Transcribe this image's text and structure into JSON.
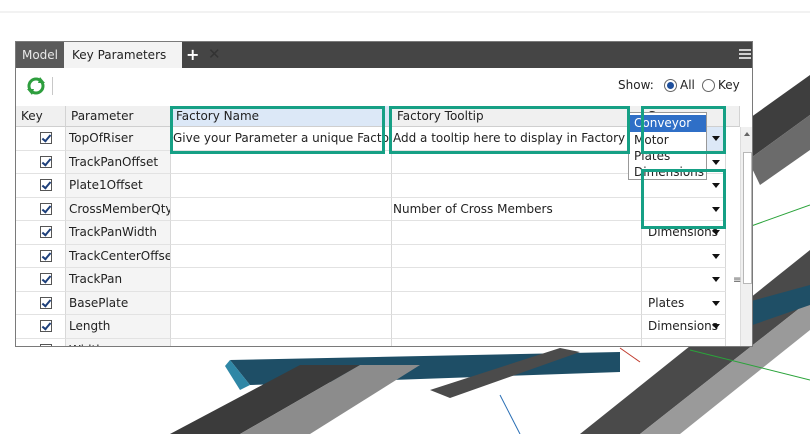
{
  "tabs": [
    {
      "label": "Model"
    },
    {
      "label": "Key Parameters"
    }
  ],
  "toolbar": {
    "show_label": "Show:",
    "options": [
      {
        "label": "All",
        "selected": true
      },
      {
        "label": "Key",
        "selected": false
      }
    ]
  },
  "columns": [
    "Key",
    "Parameter",
    "Factory Name",
    "Factory Tooltip",
    "Group"
  ],
  "rows": [
    {
      "key": true,
      "parameter": "TopOfRiser",
      "factory_name": "Give your Parameter a unique Factory Name",
      "factory_tooltip": "Add a tooltip here to display in Factory Properties",
      "group": "Conveyor"
    },
    {
      "key": true,
      "parameter": "TrackPanOffset",
      "factory_name": "",
      "factory_tooltip": "",
      "group": ""
    },
    {
      "key": true,
      "parameter": "Plate1Offset",
      "factory_name": "",
      "factory_tooltip": "",
      "group": ""
    },
    {
      "key": true,
      "parameter": "CrossMemberQty",
      "factory_name": "",
      "factory_tooltip": "Number of Cross Members",
      "group": ""
    },
    {
      "key": true,
      "parameter": "TrackPanWidth",
      "factory_name": "",
      "factory_tooltip": "",
      "group": "Dimensions"
    },
    {
      "key": true,
      "parameter": "TrackCenterOffset",
      "factory_name": "",
      "factory_tooltip": "",
      "group": ""
    },
    {
      "key": true,
      "parameter": "TrackPan",
      "factory_name": "",
      "factory_tooltip": "",
      "group": ""
    },
    {
      "key": true,
      "parameter": "BasePlate",
      "factory_name": "",
      "factory_tooltip": "",
      "group": "Plates"
    },
    {
      "key": true,
      "parameter": "Length",
      "factory_name": "",
      "factory_tooltip": "",
      "group": "Dimensions"
    },
    {
      "key": true,
      "parameter": "Width",
      "factory_name": "",
      "factory_tooltip": "",
      "group": ""
    }
  ],
  "group_dropdown": {
    "options": [
      "Conveyor",
      "Motor",
      "Plates",
      "Dimensions"
    ],
    "selected": "Conveyor"
  },
  "icons": {
    "refresh": "refresh-icon",
    "close": "close-icon",
    "add": "plus-icon",
    "menu": "hamburger-menu-icon"
  },
  "colors": {
    "highlight": "#16a085",
    "selection": "#2f6fc7",
    "tabbar": "#454545"
  }
}
